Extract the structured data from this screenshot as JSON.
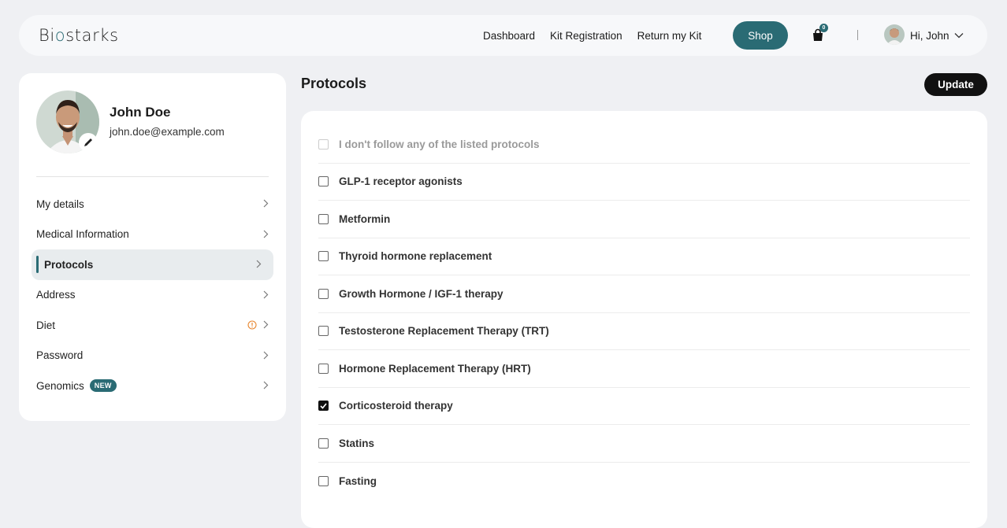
{
  "header": {
    "logo": {
      "pre": "Bi",
      "drop": "o",
      "post": "starks"
    },
    "nav": [
      "Dashboard",
      "Kit Registration",
      "Return my Kit"
    ],
    "shop_label": "Shop",
    "cart_count": "0",
    "greeting": "Hi, John",
    "icons": [
      "shopping-bag-icon",
      "chevron-down-icon"
    ]
  },
  "profile": {
    "name": "John Doe",
    "email": "john.doe@example.com"
  },
  "sidebar": {
    "items": [
      {
        "label": "My details",
        "active": false
      },
      {
        "label": "Medical Information",
        "active": false
      },
      {
        "label": "Protocols",
        "active": true
      },
      {
        "label": "Address",
        "active": false
      },
      {
        "label": "Diet",
        "active": false,
        "warning": true
      },
      {
        "label": "Password",
        "active": false
      },
      {
        "label": "Genomics",
        "active": false,
        "badge": "NEW"
      }
    ]
  },
  "main": {
    "title": "Protocols",
    "update_label": "Update",
    "protocols": [
      {
        "label": "I don't follow any of the listed protocols",
        "checked": false,
        "muted": true
      },
      {
        "label": "GLP-1 receptor agonists",
        "checked": false
      },
      {
        "label": "Metformin",
        "checked": false
      },
      {
        "label": "Thyroid hormone replacement",
        "checked": false
      },
      {
        "label": "Growth Hormone / IGF-1 therapy",
        "checked": false
      },
      {
        "label": "Testosterone Replacement Therapy (TRT)",
        "checked": false
      },
      {
        "label": "Hormone Replacement Therapy (HRT)",
        "checked": false
      },
      {
        "label": "Corticosteroid therapy",
        "checked": true
      },
      {
        "label": "Statins",
        "checked": false
      },
      {
        "label": "Fasting",
        "checked": false
      }
    ]
  },
  "colors": {
    "accent": "#2a6b74",
    "background": "#eff0f3",
    "warning": "#e8862f"
  }
}
